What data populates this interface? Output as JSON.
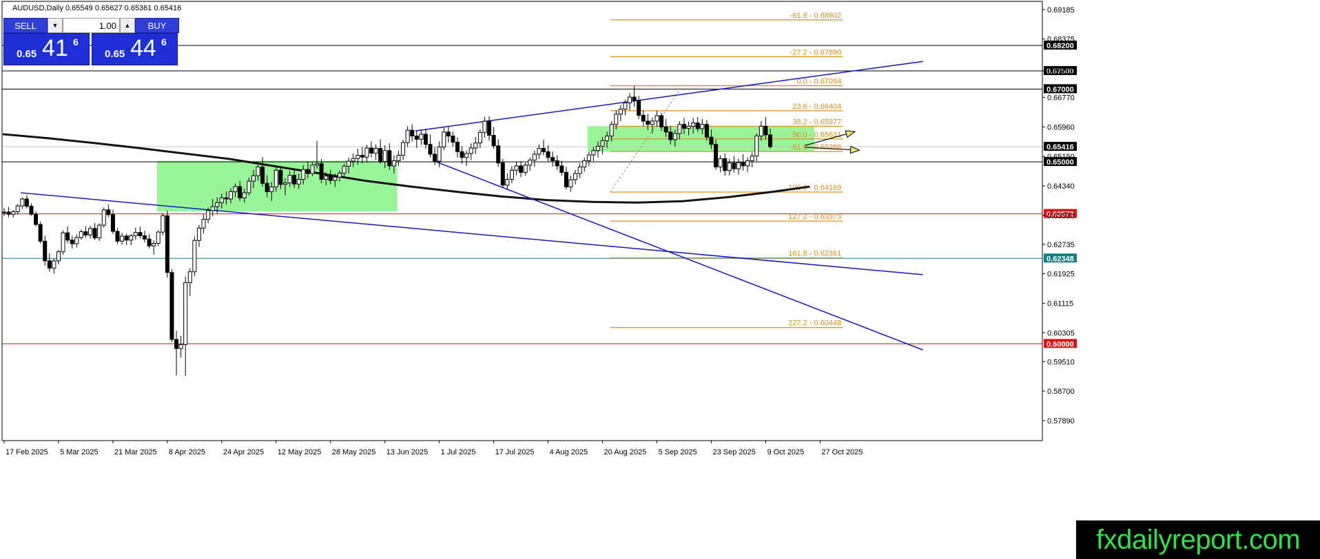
{
  "header": {
    "title": "AUDUSD,Daily  0.65549 0.65627 0.65361 0.65416"
  },
  "trade_panel": {
    "sell_label": "SELL",
    "buy_label": "BUY",
    "lot_value": "1.00",
    "sell_prefix": "0.65",
    "sell_big": "41",
    "sell_sup": "6",
    "buy_prefix": "0.65",
    "buy_big": "44",
    "buy_sup": "6"
  },
  "watermark": "fxdailyreport.com",
  "colors": {
    "fib": "#e08a1a",
    "trendline": "#1414c8",
    "support_red": "#e01010",
    "support_teal": "#108080",
    "zone": "#98f598",
    "ma": "#111111",
    "highlight_black": "#000000",
    "highlight_red": "#e01010",
    "highlight_teal": "#108080"
  },
  "chart_data": {
    "type": "candlestick",
    "symbol": "AUDUSD",
    "timeframe": "Daily",
    "ylim": [
      0.5734,
      0.6941
    ],
    "y_ticks": [
      "0.69185",
      "0.68375",
      "0.67500",
      "0.66770",
      "0.65960",
      "0.65150",
      "0.64340",
      "0.63530",
      "0.62735",
      "0.61925",
      "0.61115",
      "0.60305",
      "0.59510",
      "0.58700",
      "0.57890"
    ],
    "x_ticks": [
      "17 Feb 2025",
      "5 Mar 2025",
      "21 Mar 2025",
      "8 Apr 2025",
      "24 Apr 2025",
      "12 May 2025",
      "28 May 2025",
      "13 Jun 2025",
      "1 Jul 2025",
      "17 Jul 2025",
      "4 Aug 2025",
      "20 Aug 2025",
      "5 Sep 2025",
      "23 Sep 2025",
      "9 Oct 2025",
      "27 Oct 2025"
    ],
    "horizontal_levels": [
      {
        "price": 0.682,
        "label": "0.68200",
        "color": "black"
      },
      {
        "price": 0.675,
        "label": "0.67500",
        "color": "black"
      },
      {
        "price": 0.67,
        "label": "0.67000",
        "color": "black"
      },
      {
        "price": 0.65416,
        "label": "0.65416",
        "color": "black"
      },
      {
        "price": 0.65,
        "label": "0.65000",
        "color": "black"
      },
      {
        "price": 0.63572,
        "label": "0.63572",
        "color": "red"
      },
      {
        "price": 0.62348,
        "label": "0.62348",
        "color": "teal"
      },
      {
        "price": 0.6,
        "label": "0.60000",
        "color": "red"
      }
    ],
    "fibonacci": [
      {
        "label": "-61.8 - 0.68902",
        "price": 0.68902
      },
      {
        "label": "-27.2 - 0.67890",
        "price": 0.6789
      },
      {
        "label": "0.0 - 0.67094",
        "price": 0.67094
      },
      {
        "label": "23.6 - 0.66404",
        "price": 0.66404
      },
      {
        "label": "38.2 - 0.65977",
        "price": 0.65977
      },
      {
        "label": "50.0 - 0.65631",
        "price": 0.65631
      },
      {
        "label": "61.8 - 0.65286",
        "price": 0.65286
      },
      {
        "label": "100.0 - 0.64169",
        "price": 0.64169
      },
      {
        "label": "127.2 - 0.63373",
        "price": 0.63373
      },
      {
        "label": "161.8 - 0.62361",
        "price": 0.62361
      },
      {
        "label": "227.2 - 0.60448",
        "price": 0.60448
      }
    ],
    "candles": [
      [
        0.6362,
        0.6373,
        0.6351,
        0.6362
      ],
      [
        0.6362,
        0.6376,
        0.6348,
        0.6356
      ],
      [
        0.6356,
        0.6368,
        0.6347,
        0.6363
      ],
      [
        0.6363,
        0.6385,
        0.6355,
        0.6379
      ],
      [
        0.6379,
        0.6402,
        0.637,
        0.6398
      ],
      [
        0.6398,
        0.6409,
        0.6372,
        0.6378
      ],
      [
        0.6378,
        0.6386,
        0.6352,
        0.6356
      ],
      [
        0.6356,
        0.6364,
        0.6322,
        0.6328
      ],
      [
        0.6328,
        0.6336,
        0.6275,
        0.6282
      ],
      [
        0.6282,
        0.6297,
        0.6215,
        0.6228
      ],
      [
        0.6228,
        0.6249,
        0.6198,
        0.6208
      ],
      [
        0.6208,
        0.6235,
        0.6193,
        0.6228
      ],
      [
        0.6228,
        0.6258,
        0.6218,
        0.6253
      ],
      [
        0.6253,
        0.6312,
        0.6245,
        0.6305
      ],
      [
        0.6305,
        0.6323,
        0.6276,
        0.6285
      ],
      [
        0.6285,
        0.6297,
        0.6262,
        0.6275
      ],
      [
        0.6275,
        0.6301,
        0.6265,
        0.6292
      ],
      [
        0.6292,
        0.6314,
        0.6286,
        0.6308
      ],
      [
        0.6308,
        0.6323,
        0.6291,
        0.6299
      ],
      [
        0.6299,
        0.6324,
        0.6289,
        0.6317
      ],
      [
        0.6317,
        0.6332,
        0.6285,
        0.6291
      ],
      [
        0.6291,
        0.6331,
        0.6283,
        0.6326
      ],
      [
        0.6326,
        0.6375,
        0.6319,
        0.6368
      ],
      [
        0.6368,
        0.6383,
        0.6348,
        0.6355
      ],
      [
        0.6355,
        0.6368,
        0.6302,
        0.6309
      ],
      [
        0.6309,
        0.6318,
        0.6274,
        0.6282
      ],
      [
        0.6282,
        0.6305,
        0.6273,
        0.6296
      ],
      [
        0.6296,
        0.6303,
        0.6272,
        0.6285
      ],
      [
        0.6285,
        0.6302,
        0.6271,
        0.6297
      ],
      [
        0.6297,
        0.6319,
        0.6286,
        0.6306
      ],
      [
        0.6306,
        0.6322,
        0.6289,
        0.6297
      ],
      [
        0.6297,
        0.6311,
        0.6279,
        0.6288
      ],
      [
        0.6288,
        0.6301,
        0.6262,
        0.6269
      ],
      [
        0.6269,
        0.6285,
        0.6245,
        0.6276
      ],
      [
        0.6276,
        0.6312,
        0.6268,
        0.6307
      ],
      [
        0.6307,
        0.6359,
        0.6298,
        0.6352
      ],
      [
        0.6352,
        0.6366,
        0.6182,
        0.6196
      ],
      [
        0.6196,
        0.6205,
        0.6005,
        0.6012
      ],
      [
        0.6012,
        0.6036,
        0.5913,
        0.5987
      ],
      [
        0.5987,
        0.6022,
        0.5962,
        0.5998
      ],
      [
        0.5998,
        0.6185,
        0.5912,
        0.6168
      ],
      [
        0.6168,
        0.6208,
        0.6131,
        0.6198
      ],
      [
        0.6198,
        0.6295,
        0.6186,
        0.6284
      ],
      [
        0.6284,
        0.6327,
        0.6266,
        0.6318
      ],
      [
        0.6318,
        0.6356,
        0.6303,
        0.6342
      ],
      [
        0.6342,
        0.6375,
        0.6331,
        0.6366
      ],
      [
        0.6366,
        0.6398,
        0.6351,
        0.6377
      ],
      [
        0.6377,
        0.6403,
        0.6358,
        0.6388
      ],
      [
        0.6388,
        0.6413,
        0.6372,
        0.6401
      ],
      [
        0.6401,
        0.6419,
        0.6382,
        0.6398
      ],
      [
        0.6398,
        0.6428,
        0.6386,
        0.6418
      ],
      [
        0.6418,
        0.6441,
        0.6403,
        0.6432
      ],
      [
        0.6432,
        0.6448,
        0.6392,
        0.6401
      ],
      [
        0.6401,
        0.6426,
        0.6388,
        0.6415
      ],
      [
        0.6415,
        0.6457,
        0.6408,
        0.6447
      ],
      [
        0.6447,
        0.6478,
        0.6428,
        0.6462
      ],
      [
        0.6462,
        0.6495,
        0.6448,
        0.6486
      ],
      [
        0.6486,
        0.6513,
        0.6432,
        0.6441
      ],
      [
        0.6441,
        0.6463,
        0.6402,
        0.6418
      ],
      [
        0.6418,
        0.6445,
        0.6392,
        0.6431
      ],
      [
        0.6431,
        0.6489,
        0.6418,
        0.6477
      ],
      [
        0.6477,
        0.6488,
        0.6425,
        0.6438
      ],
      [
        0.6438,
        0.6455,
        0.6408,
        0.6442
      ],
      [
        0.6442,
        0.6475,
        0.6431,
        0.6463
      ],
      [
        0.6463,
        0.6481,
        0.6428,
        0.6439
      ],
      [
        0.6439,
        0.6468,
        0.6425,
        0.6452
      ],
      [
        0.6452,
        0.6491,
        0.6438,
        0.6479
      ],
      [
        0.6479,
        0.6501,
        0.6455,
        0.6468
      ],
      [
        0.6468,
        0.6498,
        0.6461,
        0.6491
      ],
      [
        0.6491,
        0.6558,
        0.6482,
        0.6495
      ],
      [
        0.6495,
        0.6508,
        0.6441,
        0.6452
      ],
      [
        0.6452,
        0.6472,
        0.6435,
        0.6461
      ],
      [
        0.6461,
        0.6478,
        0.6438,
        0.6449
      ],
      [
        0.6449,
        0.6468,
        0.6431,
        0.6458
      ],
      [
        0.6458,
        0.6476,
        0.6446,
        0.6469
      ],
      [
        0.6469,
        0.6495,
        0.6458,
        0.6488
      ],
      [
        0.6488,
        0.6512,
        0.6468,
        0.6502
      ],
      [
        0.6502,
        0.6523,
        0.6486,
        0.6509
      ],
      [
        0.6509,
        0.6536,
        0.6492,
        0.6518
      ],
      [
        0.6518,
        0.6541,
        0.6496,
        0.6513
      ],
      [
        0.6513,
        0.6547,
        0.6498,
        0.6538
      ],
      [
        0.6538,
        0.6556,
        0.6512,
        0.6524
      ],
      [
        0.6524,
        0.6548,
        0.6506,
        0.6537
      ],
      [
        0.6537,
        0.6562,
        0.6495,
        0.6501
      ],
      [
        0.6501,
        0.6545,
        0.6483,
        0.6531
      ],
      [
        0.6531,
        0.6551,
        0.6478,
        0.6489
      ],
      [
        0.6489,
        0.6518,
        0.6468,
        0.6503
      ],
      [
        0.6503,
        0.6531,
        0.6489,
        0.6518
      ],
      [
        0.6518,
        0.6561,
        0.6505,
        0.6553
      ],
      [
        0.6553,
        0.6598,
        0.6541,
        0.6587
      ],
      [
        0.6587,
        0.6603,
        0.6556,
        0.6571
      ],
      [
        0.6571,
        0.6586,
        0.6538,
        0.6562
      ],
      [
        0.6562,
        0.6588,
        0.6546,
        0.6576
      ],
      [
        0.6576,
        0.6591,
        0.6536,
        0.6548
      ],
      [
        0.6548,
        0.6575,
        0.6512,
        0.6521
      ],
      [
        0.6521,
        0.6541,
        0.6491,
        0.6502
      ],
      [
        0.6502,
        0.6556,
        0.6485,
        0.6541
      ],
      [
        0.6541,
        0.6594,
        0.6532,
        0.6582
      ],
      [
        0.6582,
        0.6598,
        0.6553,
        0.6571
      ],
      [
        0.6571,
        0.6583,
        0.6542,
        0.6554
      ],
      [
        0.6554,
        0.6567,
        0.6512,
        0.6528
      ],
      [
        0.6528,
        0.6543,
        0.6495,
        0.6512
      ],
      [
        0.6512,
        0.6531,
        0.6489,
        0.6523
      ],
      [
        0.6523,
        0.6551,
        0.6505,
        0.6538
      ],
      [
        0.6538,
        0.6568,
        0.6521,
        0.6552
      ],
      [
        0.6552,
        0.6589,
        0.6538,
        0.6581
      ],
      [
        0.6581,
        0.6624,
        0.6567,
        0.6612
      ],
      [
        0.6612,
        0.6625,
        0.6558,
        0.6573
      ],
      [
        0.6573,
        0.6596,
        0.6536,
        0.6544
      ],
      [
        0.6544,
        0.6562,
        0.6486,
        0.6497
      ],
      [
        0.6497,
        0.6508,
        0.6428,
        0.6436
      ],
      [
        0.6436,
        0.6468,
        0.6423,
        0.6452
      ],
      [
        0.6452,
        0.6488,
        0.6441,
        0.6477
      ],
      [
        0.6477,
        0.6501,
        0.6463,
        0.6489
      ],
      [
        0.6489,
        0.6502,
        0.6458,
        0.6471
      ],
      [
        0.6471,
        0.6498,
        0.6462,
        0.6491
      ],
      [
        0.6491,
        0.6512,
        0.6475,
        0.6505
      ],
      [
        0.6505,
        0.6531,
        0.6486,
        0.6521
      ],
      [
        0.6521,
        0.6548,
        0.6508,
        0.6537
      ],
      [
        0.6537,
        0.6561,
        0.6518,
        0.6528
      ],
      [
        0.6528,
        0.6546,
        0.6501,
        0.6512
      ],
      [
        0.6512,
        0.6528,
        0.6487,
        0.6503
      ],
      [
        0.6503,
        0.6518,
        0.6478,
        0.6489
      ],
      [
        0.6489,
        0.6503,
        0.6462,
        0.6471
      ],
      [
        0.6471,
        0.6486,
        0.6424,
        0.6431
      ],
      [
        0.6431,
        0.6462,
        0.6418,
        0.6451
      ],
      [
        0.6451,
        0.6478,
        0.6438,
        0.6468
      ],
      [
        0.6468,
        0.6496,
        0.6455,
        0.6486
      ],
      [
        0.6486,
        0.6512,
        0.6473,
        0.6503
      ],
      [
        0.6503,
        0.6528,
        0.6488,
        0.6519
      ],
      [
        0.6519,
        0.6541,
        0.6502,
        0.6531
      ],
      [
        0.6531,
        0.6556,
        0.6512,
        0.6543
      ],
      [
        0.6543,
        0.6568,
        0.6521,
        0.6558
      ],
      [
        0.6558,
        0.6583,
        0.6538,
        0.6571
      ],
      [
        0.6571,
        0.6612,
        0.6556,
        0.6603
      ],
      [
        0.6603,
        0.6642,
        0.6589,
        0.6631
      ],
      [
        0.6631,
        0.6656,
        0.6612,
        0.6645
      ],
      [
        0.6645,
        0.6671,
        0.6628,
        0.6662
      ],
      [
        0.6662,
        0.6689,
        0.6641,
        0.6678
      ],
      [
        0.6678,
        0.6709,
        0.6651,
        0.6669
      ],
      [
        0.6669,
        0.6681,
        0.6618,
        0.6628
      ],
      [
        0.6628,
        0.6642,
        0.6598,
        0.6612
      ],
      [
        0.6612,
        0.6631,
        0.6587,
        0.6603
      ],
      [
        0.6603,
        0.6622,
        0.6578,
        0.6612
      ],
      [
        0.6612,
        0.6641,
        0.6596,
        0.6627
      ],
      [
        0.6627,
        0.6635,
        0.6585,
        0.6596
      ],
      [
        0.6596,
        0.6618,
        0.6568,
        0.6582
      ],
      [
        0.6582,
        0.6598,
        0.6548,
        0.6561
      ],
      [
        0.6561,
        0.6589,
        0.6542,
        0.6578
      ],
      [
        0.6578,
        0.6612,
        0.6562,
        0.6603
      ],
      [
        0.6603,
        0.6621,
        0.6576,
        0.6592
      ],
      [
        0.6592,
        0.6611,
        0.6573,
        0.6598
      ],
      [
        0.6598,
        0.6621,
        0.6578,
        0.6607
      ],
      [
        0.6607,
        0.6623,
        0.6582,
        0.6591
      ],
      [
        0.6591,
        0.6618,
        0.6576,
        0.6603
      ],
      [
        0.6603,
        0.6615,
        0.6558,
        0.6568
      ],
      [
        0.6568,
        0.6589,
        0.6535,
        0.6548
      ],
      [
        0.6548,
        0.6561,
        0.6478,
        0.6486
      ],
      [
        0.6486,
        0.6518,
        0.6471,
        0.6509
      ],
      [
        0.6509,
        0.6523,
        0.6462,
        0.6476
      ],
      [
        0.6476,
        0.6508,
        0.6463,
        0.6497
      ],
      [
        0.6497,
        0.6516,
        0.6471,
        0.6481
      ],
      [
        0.6481,
        0.6509,
        0.6465,
        0.6498
      ],
      [
        0.6498,
        0.6521,
        0.6476,
        0.6489
      ],
      [
        0.6489,
        0.6512,
        0.6472,
        0.6503
      ],
      [
        0.6503,
        0.6526,
        0.6485,
        0.6516
      ],
      [
        0.6516,
        0.6578,
        0.6502,
        0.6571
      ],
      [
        0.6571,
        0.6612,
        0.6558,
        0.6598
      ],
      [
        0.6598,
        0.6623,
        0.6562,
        0.6574
      ],
      [
        0.6574,
        0.6591,
        0.6536,
        0.6542
      ]
    ],
    "moving_average": [
      [
        0,
        0.6576
      ],
      [
        10,
        0.6565
      ],
      [
        20,
        0.6552
      ],
      [
        30,
        0.6538
      ],
      [
        40,
        0.6523
      ],
      [
        50,
        0.6508
      ],
      [
        60,
        0.6488
      ],
      [
        70,
        0.6468
      ],
      [
        80,
        0.6448
      ],
      [
        90,
        0.6432
      ],
      [
        100,
        0.6418
      ],
      [
        110,
        0.6405
      ],
      [
        120,
        0.6395
      ],
      [
        130,
        0.639
      ],
      [
        140,
        0.6388
      ],
      [
        150,
        0.6392
      ],
      [
        160,
        0.6403
      ],
      [
        170,
        0.6418
      ],
      [
        178,
        0.6432
      ]
    ],
    "demand_zones": [
      {
        "from_index": 34,
        "to_index": 87,
        "top": 0.6503,
        "bottom": 0.6364
      },
      {
        "from_index": 129,
        "to_index": 179,
        "top": 0.6598,
        "bottom": 0.6528
      }
    ],
    "trendlines": [
      {
        "from": [
          4,
          0.6415
        ],
        "to": [
          184,
          0.619
        ]
      },
      {
        "from": [
          91,
          0.6585
        ],
        "to": [
          184,
          0.6776
        ]
      },
      {
        "from": [
          95,
          0.6503
        ],
        "to": [
          184,
          0.5983
        ]
      }
    ],
    "projection_arrows": [
      {
        "from": [
          177,
          0.6545
        ],
        "to": [
          188,
          0.6583
        ]
      },
      {
        "from": [
          177,
          0.654
        ],
        "to": [
          189,
          0.6532
        ]
      }
    ]
  }
}
